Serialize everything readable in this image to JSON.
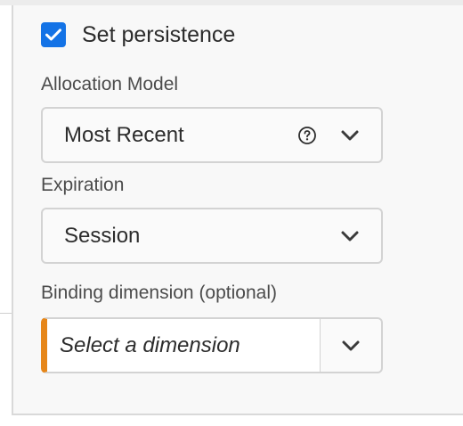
{
  "persistence": {
    "checked": true,
    "label": "Set persistence"
  },
  "allocation_model": {
    "label": "Allocation Model",
    "value": "Most Recent",
    "help_icon": "help-circle-icon"
  },
  "expiration": {
    "label": "Expiration",
    "value": "Session"
  },
  "binding_dimension": {
    "label": "Binding dimension (optional)",
    "placeholder": "Select a dimension"
  },
  "colors": {
    "checkbox": "#1473e6",
    "invalid_edge": "#e68619"
  }
}
